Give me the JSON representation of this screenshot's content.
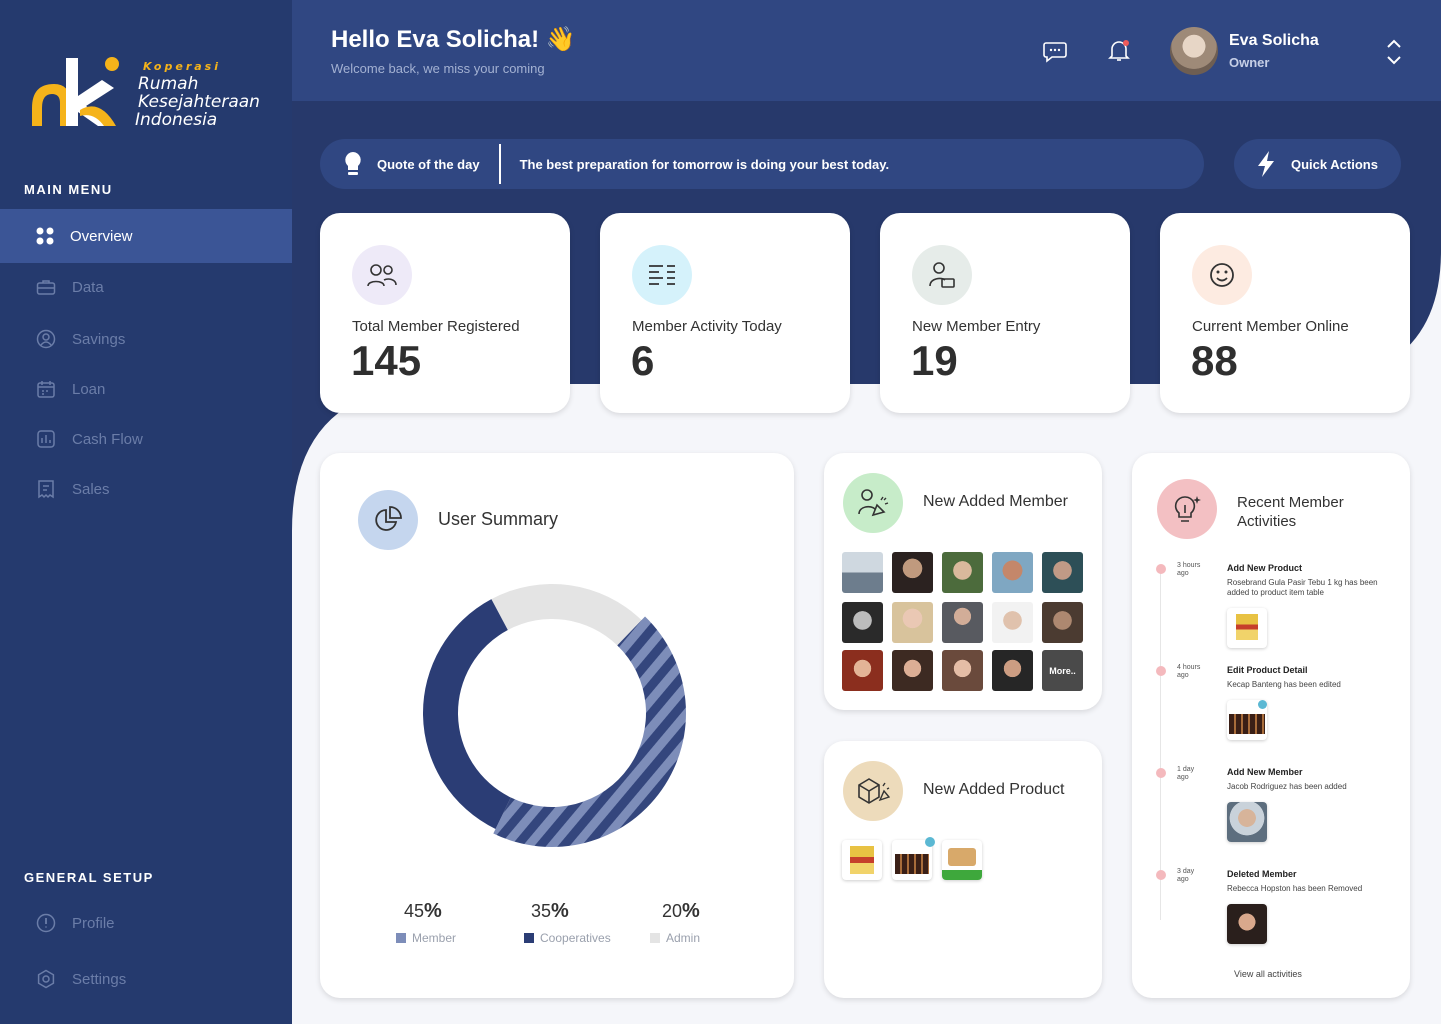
{
  "brand": {
    "line1": "Koperasi",
    "line2": "Rumah",
    "line3": "Kesejahteraan",
    "line4": "Indonesia",
    "accent": "#f5b31a"
  },
  "sidebar": {
    "main_menu_heading": "MAIN MENU",
    "items": [
      {
        "label": "Overview",
        "icon": "grid-icon",
        "active": true
      },
      {
        "label": "Data",
        "icon": "briefcase-icon"
      },
      {
        "label": "Savings",
        "icon": "user-circle-icon"
      },
      {
        "label": "Loan",
        "icon": "calendar-icon"
      },
      {
        "label": "Cash Flow",
        "icon": "bar-chart-icon"
      },
      {
        "label": "Sales",
        "icon": "receipt-icon"
      }
    ],
    "general_heading": "GENERAL SETUP",
    "general_items": [
      {
        "label": "Profile",
        "icon": "info-circle-icon"
      },
      {
        "label": "Settings",
        "icon": "gear-icon"
      }
    ]
  },
  "header": {
    "greeting": "Hello Eva Solicha! 👋",
    "subtitle": "Welcome back, we miss your coming",
    "user_name": "Eva Solicha",
    "user_role": "Owner"
  },
  "quote": {
    "label": "Quote of the day",
    "text": "The best preparation for tomorrow is doing your best today."
  },
  "quick_actions": {
    "label": "Quick Actions"
  },
  "stats": [
    {
      "label": "Total Member Registered",
      "value": "145",
      "color": "#eeeaf8"
    },
    {
      "label": "Member Activity Today",
      "value": "6",
      "color": "#d5f2fb"
    },
    {
      "label": "New Member Entry",
      "value": "19",
      "color": "#e6ece9"
    },
    {
      "label": "Current Member Online",
      "value": "88",
      "color": "#fdebe1"
    }
  ],
  "user_summary": {
    "title": "User Summary",
    "segments": [
      {
        "pct": "45",
        "label": "Member",
        "color": "#7d8db9"
      },
      {
        "pct": "35",
        "label": "Cooperatives",
        "color": "#2b3d75"
      },
      {
        "pct": "20",
        "label": "Admin",
        "color": "#e4e4e4"
      }
    ]
  },
  "new_member": {
    "title": "New Added Member",
    "more_label": "More.."
  },
  "new_product": {
    "title": "New Added Product"
  },
  "activities": {
    "title": "Recent Member Activities",
    "items": [
      {
        "time1": "3 hours",
        "time2": "ago",
        "title": "Add New Product",
        "desc": "Rosebrand Gula Pasir Tebu 1 kg has been added to product item table"
      },
      {
        "time1": "4 hours",
        "time2": "ago",
        "title": "Edit Product Detail",
        "desc": "Kecap Banteng has been edited"
      },
      {
        "time1": "1 day",
        "time2": "ago",
        "title": "Add New Member",
        "desc": "Jacob Rodriguez has been added"
      },
      {
        "time1": "3 day",
        "time2": "ago",
        "title": "Deleted Member",
        "desc": "Rebecca Hopston has been Removed"
      }
    ],
    "view_all": "View all activities"
  }
}
